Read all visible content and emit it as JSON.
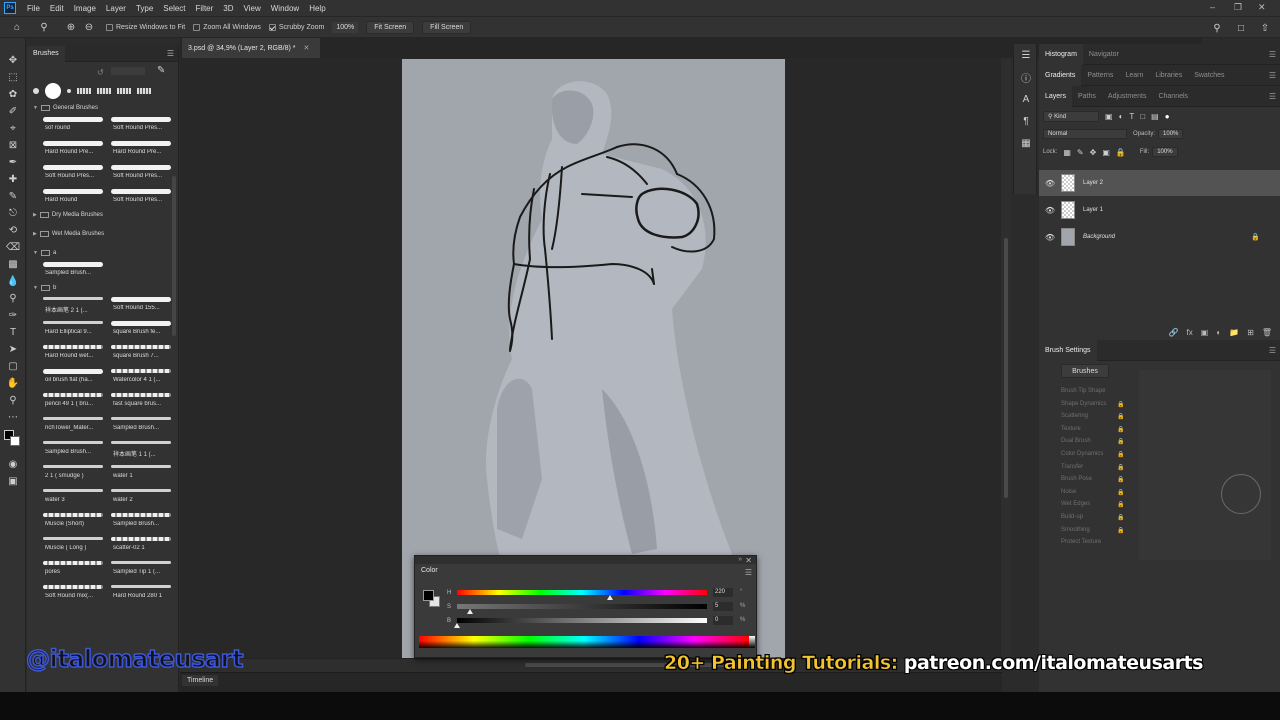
{
  "menu": {
    "items": [
      "File",
      "Edit",
      "Image",
      "Layer",
      "Type",
      "Select",
      "Filter",
      "3D",
      "View",
      "Window",
      "Help"
    ]
  },
  "options_bar": {
    "resize_windows": "Resize Windows to Fit",
    "zoom_all_windows": "Zoom All Windows",
    "scrubby_zoom": "Scrubby Zoom",
    "zoom_value": "100%",
    "fit_screen": "Fit Screen",
    "fill_screen": "Fill Screen"
  },
  "brushes_panel": {
    "title": "Brushes",
    "groups": {
      "general": "General Brushes",
      "dry_media": "Dry Media Brushes",
      "wet_media": "Wet Media Brushes",
      "a": "a",
      "b": "b"
    },
    "general_brushes": [
      "sof round",
      "Soft Round Pres...",
      "Hard Round Pre...",
      "Hard Round Pre...",
      "Soft Round Pres...",
      "Soft Round Pres...",
      "Hard Round",
      "Soft Round Pres..."
    ],
    "a_brushes": [
      "Sampled Brush..."
    ],
    "b_brushes": [
      "祥本画笔 2 1 (...",
      "Soft Round 155...",
      "Hard Elliptical 9...",
      "square Brush fe...",
      "Hard Round wet...",
      "square Brush 7...",
      "oil brush flat (ha...",
      "Watercolor 4 1 (...",
      "pencil 49 1 ( bru...",
      "fast square brus...",
      "richTowel_Mater...",
      "Sampled Brush...",
      "Sampled Brush...",
      "祥本画笔 1 1 (...",
      "2 1 ( smudge )",
      "water 1",
      "water 3",
      "water 2",
      "Muscle (Short)",
      "Sampled Brush...",
      "Muscle ( Long )",
      "scatter-02 1",
      "pores",
      "Sampled Tip 1 (...",
      "Soft Round mix(...",
      "Hard Round 280 1"
    ]
  },
  "document": {
    "tab_title": "3.psd @ 34,9% (Layer 2, RGB/8) *",
    "timeline_tab": "Timeline"
  },
  "color_panel": {
    "title": "Color",
    "h_label": "H",
    "s_label": "S",
    "b_label": "B",
    "h_value": "220",
    "s_value": "5",
    "b_value": "0",
    "h_unit": "°",
    "s_unit": "%",
    "b_unit": "%",
    "h_level": 0.611,
    "s_level": 0.05,
    "b_level": 0.0
  },
  "right_panels": {
    "top_tabs": [
      "Histogram",
      "Navigator"
    ],
    "mid_tabs": [
      "Gradients",
      "Patterns",
      "Learn",
      "Libraries",
      "Swatches"
    ],
    "layer_tabs": [
      "Layers",
      "Paths",
      "Adjustments",
      "Channels"
    ],
    "filter_kind": "Kind",
    "blend_mode": "Normal",
    "opacity_label": "Opacity:",
    "opacity_value": "100%",
    "lock_label": "Lock:",
    "fill_label": "Fill:",
    "fill_value": "100%",
    "layers": [
      "Layer 2",
      "Layer 1",
      "Background"
    ],
    "brush_settings_title": "Brush Settings",
    "brushes_button": "Brushes",
    "brush_options": [
      "Brush Tip Shape",
      "Shape Dynamics",
      "Scattering",
      "Texture",
      "Dual Brush",
      "Color Dynamics",
      "Transfer",
      "Brush Pose",
      "Noise",
      "Wet Edges",
      "Build-up",
      "Smoothing",
      "Protect Texture"
    ]
  },
  "watermarks": {
    "handle": "@italomateusart",
    "promo_lead": "20+ Painting Tutorials:",
    "promo_url": "patreon.com/italomateusarts"
  },
  "colors": {
    "accent": "#31a8ff",
    "canvas_bg": "#a1a5ac",
    "promo_yellow": "#f4c430"
  }
}
